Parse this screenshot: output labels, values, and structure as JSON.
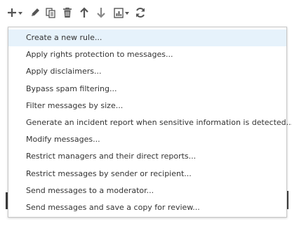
{
  "toolbar": {
    "buttons": [
      {
        "name": "add-icon",
        "has_dropdown": true
      },
      {
        "name": "edit-icon"
      },
      {
        "name": "copy-icon"
      },
      {
        "name": "delete-icon"
      },
      {
        "name": "move-up-icon"
      },
      {
        "name": "move-down-icon"
      },
      {
        "name": "report-icon",
        "has_dropdown": true
      },
      {
        "name": "refresh-icon"
      }
    ]
  },
  "menu": {
    "selected_index": 0,
    "items": [
      {
        "label": "Create a new rule..."
      },
      {
        "label": "Apply rights protection to messages..."
      },
      {
        "label": "Apply disclaimers..."
      },
      {
        "label": "Bypass spam filtering..."
      },
      {
        "label": "Filter messages by size..."
      },
      {
        "label": "Generate an incident report when sensitive information is detected..."
      },
      {
        "label": "Modify messages..."
      },
      {
        "label": "Restrict managers and their direct reports..."
      },
      {
        "label": "Restrict messages by sender or recipient..."
      },
      {
        "label": "Send messages to a moderator..."
      },
      {
        "label": "Send messages and save a copy for review..."
      }
    ]
  },
  "colors": {
    "selected_background": "#e6f2fb",
    "menu_border": "#c6c6c6",
    "text": "#333333",
    "icon": "#555555"
  }
}
